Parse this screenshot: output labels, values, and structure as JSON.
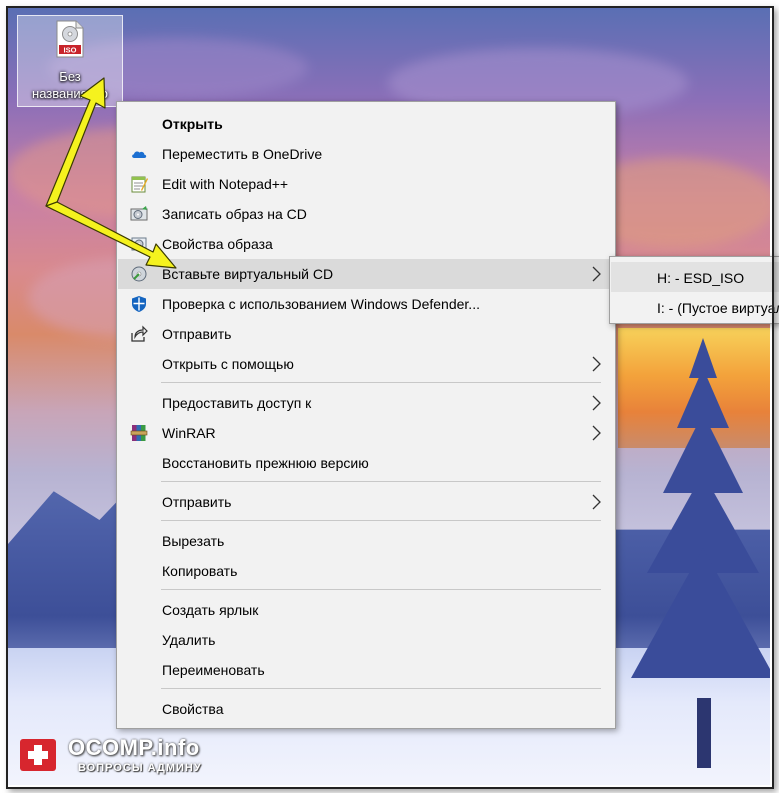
{
  "desktop": {
    "icon": {
      "line1": "Без",
      "line2": "названия.iso",
      "badge": "ISO"
    }
  },
  "menu": {
    "items": [
      {
        "label": "Открыть",
        "bold": true,
        "icon": "none"
      },
      {
        "label": "Переместить в OneDrive",
        "icon": "onedrive-icon"
      },
      {
        "label": "Edit with Notepad++",
        "icon": "notepad-plus-plus-icon"
      },
      {
        "label": "Записать образ на CD",
        "icon": "burn-disc-icon"
      },
      {
        "label": "Свойства образа",
        "icon": "image-properties-icon"
      },
      {
        "label": "Вставьте виртуальный CD",
        "icon": "virtual-cd-icon",
        "submenu": true,
        "highlighted": true
      },
      {
        "label": "Проверка с использованием Windows Defender...",
        "icon": "windows-defender-icon"
      },
      {
        "label": "Отправить",
        "icon": "share-icon"
      },
      {
        "label": "Открыть с помощью",
        "icon": "none",
        "submenu": true
      },
      {
        "label": "Предоставить доступ к",
        "icon": "none",
        "submenu": true
      },
      {
        "label": "WinRAR",
        "icon": "winrar-icon",
        "submenu": true
      },
      {
        "label": "Восстановить прежнюю версию",
        "icon": "none"
      },
      {
        "label": "Отправить",
        "icon": "none",
        "submenu": true
      },
      {
        "label": "Вырезать",
        "icon": "none"
      },
      {
        "label": "Копировать",
        "icon": "none"
      },
      {
        "label": "Создать ярлык",
        "icon": "none"
      },
      {
        "label": "Удалить",
        "icon": "none"
      },
      {
        "label": "Переименовать",
        "icon": "none"
      },
      {
        "label": "Свойства",
        "icon": "none"
      }
    ]
  },
  "submenu": {
    "items": [
      {
        "label": "H: - ESD_ISO",
        "highlighted": true
      },
      {
        "label": "I: - (Пустое виртуальный CD)"
      }
    ]
  },
  "watermark": {
    "title": "OCOMP.info",
    "subtitle": "ВОПРОСЫ АДМИНУ"
  },
  "colors": {
    "menu_bg": "#f2f2f2",
    "menu_highlight": "#dadada",
    "arrow": "#f5f21e",
    "watermark_red": "#d7262e"
  }
}
